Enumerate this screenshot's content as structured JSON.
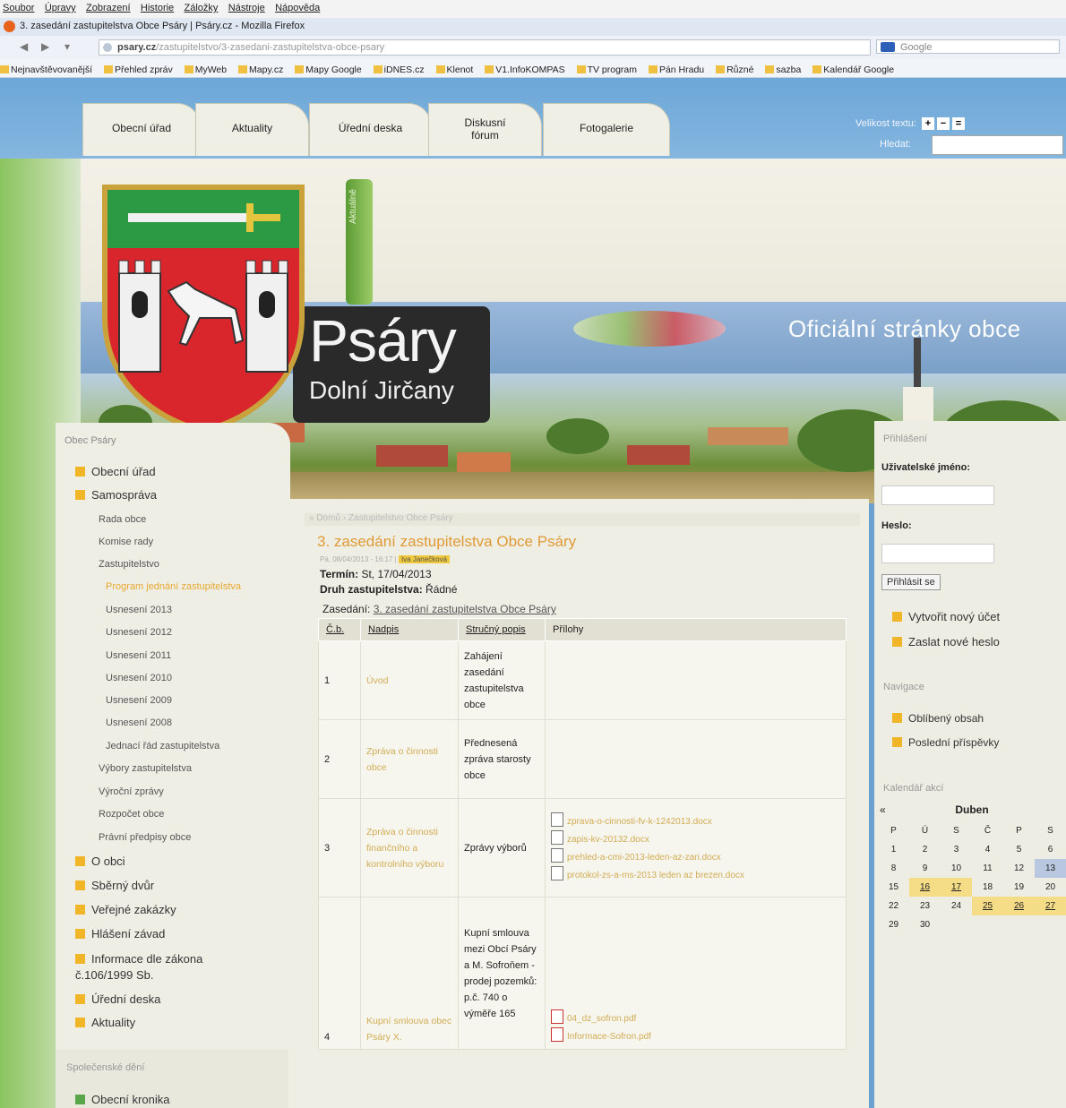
{
  "browser": {
    "menu": [
      "Soubor",
      "Úpravy",
      "Zobrazení",
      "Historie",
      "Záložky",
      "Nástroje",
      "Nápověda"
    ],
    "window_title": "3. zasedání zastupitelstva Obce Psáry | Psáry.cz - Mozilla Firefox",
    "url_domain": "psary.cz",
    "url_path": "/zastupitelstvo/3-zasedani-zastupitelstva-obce-psary",
    "search_engine": "Google",
    "bookmarks": [
      "Nejnavštěvovanější",
      "Přehled zpráv",
      "MyWeb",
      "Mapy.cz",
      "Mapy Google",
      "iDNES.cz",
      "Klenot",
      "V1.InfoKOMPAS",
      "TV program",
      "Pán Hradu",
      "Různé",
      "sazba",
      "Kalendář Google"
    ]
  },
  "site": {
    "tabs": [
      "Obecní úřad",
      "Aktuality",
      "Úřední deska",
      "Diskusní fórum",
      "Fotogalerie"
    ],
    "size_label": "Velikost textu:",
    "size_buttons": [
      "+",
      "−",
      "="
    ],
    "search_label": "Hledat:",
    "aktualne_label": "Aktuálně",
    "logo_title": "Psáry",
    "logo_subtitle": "Dolní Jirčany",
    "tagline": "Oficiální stránky obce"
  },
  "left_nav": {
    "heading": "Obec Psáry",
    "items": [
      {
        "label": "Obecní úřad",
        "level": 1
      },
      {
        "label": "Samospráva",
        "level": 1
      },
      {
        "label": "Rada obce",
        "level": 2
      },
      {
        "label": "Komise rady",
        "level": 2
      },
      {
        "label": "Zastupitelstvo",
        "level": 2
      },
      {
        "label": "Program jednání zastupitelstva",
        "level": 3,
        "active": true
      },
      {
        "label": "Usnesení 2013",
        "level": 3
      },
      {
        "label": "Usnesení 2012",
        "level": 3
      },
      {
        "label": "Usnesení 2011",
        "level": 3
      },
      {
        "label": "Usnesení 2010",
        "level": 3
      },
      {
        "label": "Usnesení 2009",
        "level": 3
      },
      {
        "label": "Usnesení 2008",
        "level": 3
      },
      {
        "label": "Jednací řád zastupitelstva",
        "level": 3
      },
      {
        "label": "Výbory zastupitelstva",
        "level": 2
      },
      {
        "label": "Výroční zprávy",
        "level": 2
      },
      {
        "label": "Rozpočet obce",
        "level": 2
      },
      {
        "label": "Právní předpisy obce",
        "level": 2
      },
      {
        "label": "O obci",
        "level": 1
      },
      {
        "label": "Sběrný dvůr",
        "level": 1
      },
      {
        "label": "Veřejné zakázky",
        "level": 1
      },
      {
        "label": "Hlášení závad",
        "level": 1
      },
      {
        "label": "Informace dle zákona č.106/1999 Sb.",
        "level": 1
      },
      {
        "label": "Úřední deska",
        "level": 1
      },
      {
        "label": "Aktuality",
        "level": 1
      }
    ],
    "section2_heading": "Společenské dění",
    "section2_item": "Obecní kronika"
  },
  "content": {
    "breadcrumb": "» Domů › Zastupitelstvo Obce Psáry",
    "title": "3. zasedání zastupitelstva Obce Psáry",
    "meta_date": "Pá, 08/04/2013 - 16:17 |",
    "meta_author": "Iva Janečková",
    "termin_label": "Termín:",
    "termin_value": "St, 17/04/2013",
    "druh_label": "Druh zastupitelstva:",
    "druh_value": "Řádné",
    "zasedani_label": "Zasedání:",
    "zasedani_link": "3. zasedání zastupitelstva Obce Psáry",
    "columns": [
      "Č.b.",
      "Nadpis",
      "Stručný popis",
      "Přílohy"
    ],
    "rows": [
      {
        "num": "1",
        "nadpis": "Úvod",
        "popis": "Zahájení zasedání zastupitelstva obce",
        "files": []
      },
      {
        "num": "2",
        "nadpis": "Zpráva o činnosti obce",
        "popis": "Přednesená zpráva starosty obce",
        "files": []
      },
      {
        "num": "3",
        "nadpis": "Zpráva o činnosti finančního a kontrolního výboru",
        "popis": "Zprávy výborů",
        "files": [
          {
            "name": "zprava-o-cinnosti-fv-k-1242013.docx",
            "type": "doc"
          },
          {
            "name": "zapis-kv-20132.docx",
            "type": "doc"
          },
          {
            "name": "prehled-a-cmi-2013-leden-az-zari.docx",
            "type": "doc"
          },
          {
            "name": "protokol-zs-a-ms-2013 leden az brezen.docx",
            "type": "doc"
          }
        ]
      },
      {
        "num": "4",
        "nadpis": "Kupní smlouva obec Psáry X.",
        "popis": "Kupní smlouva mezi Obcí Psáry a M. Sofroňem - prodej pozemků: p.č. 740 o výměře 165",
        "files": [
          {
            "name": "04_dz_sofron.pdf",
            "type": "pdf"
          },
          {
            "name": "Informace-Sofron.pdf",
            "type": "pdf"
          }
        ]
      }
    ]
  },
  "right": {
    "login_heading": "Přihlášení",
    "username_label": "Uživatelské jméno:",
    "password_label": "Heslo:",
    "login_button": "Přihlásit se",
    "links": [
      "Vytvořit nový účet",
      "Zaslat nové heslo"
    ],
    "nav_heading": "Navigace",
    "nav_links": [
      "Oblíbený obsah",
      "Poslední příspěvky"
    ],
    "cal_heading": "Kalendář akcí",
    "cal_prev": "«",
    "cal_month": "Duben",
    "cal_days": [
      "P",
      "Ú",
      "S",
      "Č",
      "P",
      "S"
    ],
    "cal_weeks": [
      [
        "1",
        "2",
        "3",
        "4",
        "5",
        "6"
      ],
      [
        "8",
        "9",
        "10",
        "11",
        "12",
        "13"
      ],
      [
        "15",
        "16",
        "17",
        "18",
        "19",
        "20"
      ],
      [
        "22",
        "23",
        "24",
        "25",
        "26",
        "27"
      ],
      [
        "29",
        "30",
        "",
        "",
        "",
        ""
      ]
    ],
    "cal_highlight": [
      "16",
      "17",
      "25",
      "26",
      "27"
    ],
    "cal_today": "13"
  }
}
